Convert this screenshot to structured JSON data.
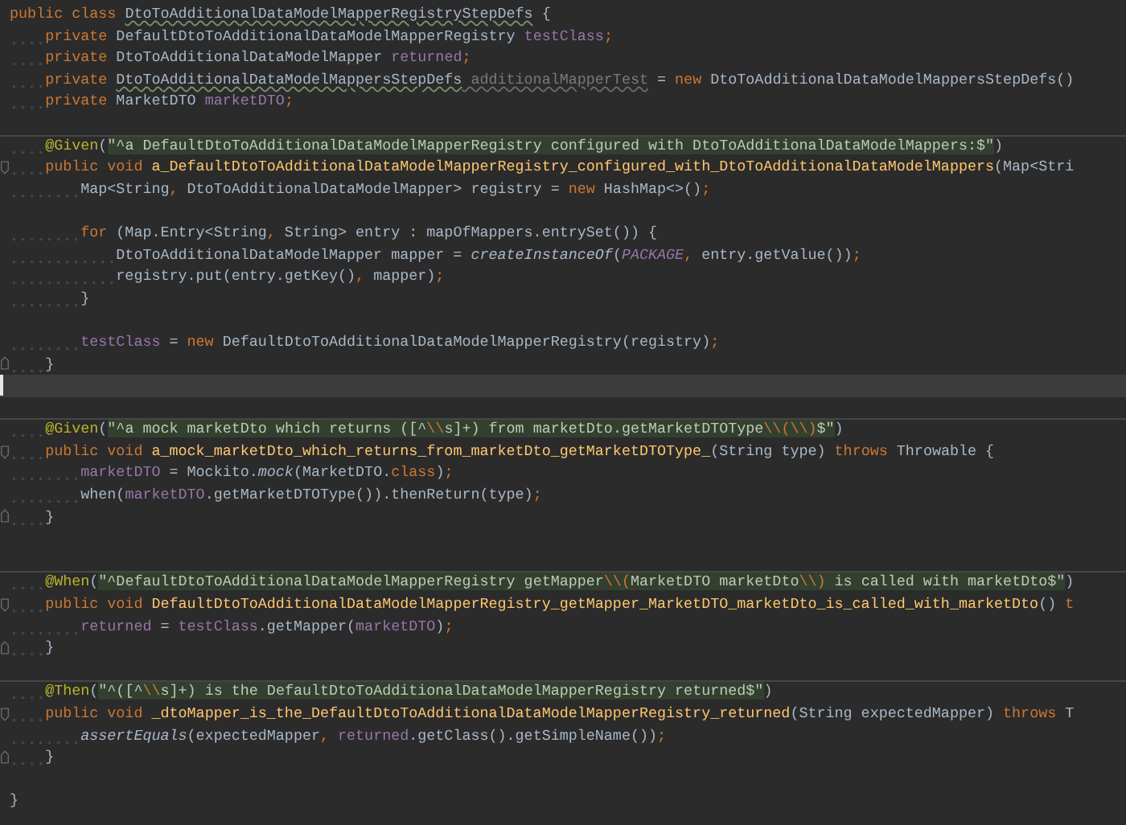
{
  "editor": {
    "blocks": [
      {
        "lines": [
          {
            "kind": "plain",
            "current": false,
            "tokens": [
              {
                "kind": "keyword",
                "text": "public class "
              },
              {
                "kind": "typo",
                "text": "DtoToAdditionalDataModelMapperRegistryStepDefs"
              },
              {
                "kind": "plain",
                "text": " {"
              }
            ]
          },
          {
            "kind": "plain",
            "current": false,
            "tokens": [
              {
                "kind": "keyword",
                "text": "    private"
              },
              {
                "kind": "plain",
                "text": " DefaultDtoToAdditionalDataModelMapperRegistry "
              },
              {
                "kind": "field",
                "text": "testClass"
              },
              {
                "kind": "punct",
                "text": ";"
              }
            ]
          },
          {
            "kind": "plain",
            "current": false,
            "tokens": [
              {
                "kind": "keyword",
                "text": "    private"
              },
              {
                "kind": "plain",
                "text": " DtoToAdditionalDataModelMapper "
              },
              {
                "kind": "field",
                "text": "returned"
              },
              {
                "kind": "punct",
                "text": ";"
              }
            ]
          },
          {
            "kind": "plain",
            "current": false,
            "tokens": [
              {
                "kind": "keyword",
                "text": "    private "
              },
              {
                "kind": "typo",
                "text": "DtoToAdditionalDataModelMappersStepDefs"
              },
              {
                "kind": "unused",
                "text": " additionalMapperTest"
              },
              {
                "kind": "plain",
                "text": " = "
              },
              {
                "kind": "keyword",
                "text": "new"
              },
              {
                "kind": "plain",
                "text": " DtoToAdditionalDataModelMappersStepDefs()"
              }
            ]
          },
          {
            "kind": "plain",
            "current": false,
            "tokens": [
              {
                "kind": "keyword",
                "text": "    private"
              },
              {
                "kind": "plain",
                "text": " MarketDTO "
              },
              {
                "kind": "field",
                "text": "marketDTO"
              },
              {
                "kind": "punct",
                "text": ";"
              }
            ]
          },
          {
            "kind": "plain",
            "current": false
          }
        ]
      },
      {
        "lines": [
          {
            "kind": "plain",
            "current": false,
            "tokens": [
              {
                "kind": "annotation",
                "text": "    @Given"
              },
              {
                "kind": "plain",
                "text": "("
              },
              {
                "kind": "string",
                "text": "\"^a DefaultDtoToAdditionalDataModelMapperRegistry configured with DtoToAdditionalDataModelMappers:$\""
              },
              {
                "kind": "plain",
                "text": ")"
              }
            ]
          },
          {
            "kind": "fold-start",
            "current": false,
            "tokens": [
              {
                "kind": "keyword",
                "text": "    public void "
              },
              {
                "kind": "method",
                "text": "a_DefaultDtoToAdditionalDataModelMapperRegistry_configured_with_DtoToAdditionalDataModelMappers"
              },
              {
                "kind": "plain",
                "text": "(Map<Stri"
              }
            ]
          },
          {
            "kind": "plain",
            "current": false,
            "tokens": [
              {
                "kind": "plain",
                "text": "        Map<String"
              },
              {
                "kind": "punct",
                "text": ","
              },
              {
                "kind": "plain",
                "text": " DtoToAdditionalDataModelMapper> registry = "
              },
              {
                "kind": "keyword",
                "text": "new"
              },
              {
                "kind": "plain",
                "text": " HashMap<>()"
              },
              {
                "kind": "punct",
                "text": ";"
              }
            ]
          },
          {
            "kind": "plain",
            "current": false
          },
          {
            "kind": "plain",
            "current": false,
            "tokens": [
              {
                "kind": "keyword",
                "text": "        for"
              },
              {
                "kind": "plain",
                "text": " (Map.Entry<String"
              },
              {
                "kind": "punct",
                "text": ","
              },
              {
                "kind": "plain",
                "text": " String> entry : mapOfMappers.entrySet()) {"
              }
            ]
          },
          {
            "kind": "plain",
            "current": false,
            "tokens": [
              {
                "kind": "plain",
                "text": "            DtoToAdditionalDataModelMapper mapper = "
              },
              {
                "kind": "italic",
                "text": "createInstanceOf"
              },
              {
                "kind": "plain",
                "text": "("
              },
              {
                "kind": "constant",
                "text": "PACKAGE"
              },
              {
                "kind": "punct",
                "text": ","
              },
              {
                "kind": "plain",
                "text": " entry.getValue())"
              },
              {
                "kind": "punct",
                "text": ";"
              }
            ]
          },
          {
            "kind": "plain",
            "current": false,
            "tokens": [
              {
                "kind": "plain",
                "text": "            registry.put(entry.getKey()"
              },
              {
                "kind": "punct",
                "text": ","
              },
              {
                "kind": "plain",
                "text": " mapper)"
              },
              {
                "kind": "punct",
                "text": ";"
              }
            ]
          },
          {
            "kind": "plain",
            "current": false,
            "tokens": [
              {
                "kind": "plain",
                "text": "        }"
              }
            ]
          },
          {
            "kind": "plain",
            "current": false
          },
          {
            "kind": "plain",
            "current": false,
            "tokens": [
              {
                "kind": "field",
                "text": "        testClass"
              },
              {
                "kind": "plain",
                "text": " = "
              },
              {
                "kind": "keyword",
                "text": "new"
              },
              {
                "kind": "plain",
                "text": " DefaultDtoToAdditionalDataModelMapperRegistry(registry)"
              },
              {
                "kind": "punct",
                "text": ";"
              }
            ]
          },
          {
            "kind": "fold-end",
            "current": false,
            "tokens": [
              {
                "kind": "plain",
                "text": "    }"
              }
            ]
          },
          {
            "kind": "plain",
            "current": true
          },
          {
            "kind": "plain",
            "current": false
          }
        ]
      },
      {
        "lines": [
          {
            "kind": "plain",
            "current": false,
            "tokens": [
              {
                "kind": "annotation",
                "text": "    @Given"
              },
              {
                "kind": "plain",
                "text": "("
              },
              {
                "kind": "string",
                "text": "\"^a mock marketDto which returns ([^"
              },
              {
                "kind": "escape",
                "text": "\\\\"
              },
              {
                "kind": "string",
                "text": "s]+) from marketDto.getMarketDTOType"
              },
              {
                "kind": "escape",
                "text": "\\\\(\\\\)"
              },
              {
                "kind": "string",
                "text": "$\""
              },
              {
                "kind": "plain",
                "text": ")"
              }
            ]
          },
          {
            "kind": "fold-start",
            "current": false,
            "tokens": [
              {
                "kind": "keyword",
                "text": "    public void "
              },
              {
                "kind": "method",
                "text": "a_mock_marketDto_which_returns_from_marketDto_getMarketDTOType_"
              },
              {
                "kind": "plain",
                "text": "(String type) "
              },
              {
                "kind": "keyword",
                "text": "throws"
              },
              {
                "kind": "plain",
                "text": " Throwable {"
              }
            ]
          },
          {
            "kind": "plain",
            "current": false,
            "tokens": [
              {
                "kind": "field",
                "text": "        marketDTO"
              },
              {
                "kind": "plain",
                "text": " = Mockito."
              },
              {
                "kind": "italic",
                "text": "mock"
              },
              {
                "kind": "plain",
                "text": "(MarketDTO."
              },
              {
                "kind": "keyword",
                "text": "class"
              },
              {
                "kind": "plain",
                "text": ")"
              },
              {
                "kind": "punct",
                "text": ";"
              }
            ]
          },
          {
            "kind": "plain",
            "current": false,
            "tokens": [
              {
                "kind": "plain",
                "text": "        when("
              },
              {
                "kind": "field",
                "text": "marketDTO"
              },
              {
                "kind": "plain",
                "text": ".getMarketDTOType()).thenReturn(type)"
              },
              {
                "kind": "punct",
                "text": ";"
              }
            ]
          },
          {
            "kind": "fold-end",
            "current": false,
            "tokens": [
              {
                "kind": "plain",
                "text": "    }"
              }
            ]
          },
          {
            "kind": "plain",
            "current": false
          },
          {
            "kind": "plain",
            "current": false
          }
        ]
      },
      {
        "lines": [
          {
            "kind": "plain",
            "current": false,
            "tokens": [
              {
                "kind": "annotation",
                "text": "    @When"
              },
              {
                "kind": "plain",
                "text": "("
              },
              {
                "kind": "string",
                "text": "\"^DefaultDtoToAdditionalDataModelMapperRegistry getMapper"
              },
              {
                "kind": "escape",
                "text": "\\\\("
              },
              {
                "kind": "string",
                "text": "MarketDTO marketDto"
              },
              {
                "kind": "escape",
                "text": "\\\\)"
              },
              {
                "kind": "string",
                "text": " is called with marketDto$\""
              },
              {
                "kind": "plain",
                "text": ")"
              }
            ]
          },
          {
            "kind": "fold-start",
            "current": false,
            "tokens": [
              {
                "kind": "keyword",
                "text": "    public void "
              },
              {
                "kind": "method",
                "text": "DefaultDtoToAdditionalDataModelMapperRegistry_getMapper_MarketDTO_marketDto_is_called_with_marketDto"
              },
              {
                "kind": "plain",
                "text": "() "
              },
              {
                "kind": "keyword",
                "text": "t"
              }
            ]
          },
          {
            "kind": "plain",
            "current": false,
            "tokens": [
              {
                "kind": "field",
                "text": "        returned"
              },
              {
                "kind": "plain",
                "text": " = "
              },
              {
                "kind": "field",
                "text": "testClass"
              },
              {
                "kind": "plain",
                "text": ".getMapper("
              },
              {
                "kind": "field",
                "text": "marketDTO"
              },
              {
                "kind": "plain",
                "text": ")"
              },
              {
                "kind": "punct",
                "text": ";"
              }
            ]
          },
          {
            "kind": "fold-end",
            "current": false,
            "tokens": [
              {
                "kind": "plain",
                "text": "    }"
              }
            ]
          },
          {
            "kind": "plain",
            "current": false
          }
        ]
      },
      {
        "lines": [
          {
            "kind": "plain",
            "current": false,
            "tokens": [
              {
                "kind": "annotation",
                "text": "    @Then"
              },
              {
                "kind": "plain",
                "text": "("
              },
              {
                "kind": "string",
                "text": "\"^([^"
              },
              {
                "kind": "escape",
                "text": "\\\\"
              },
              {
                "kind": "string",
                "text": "s]+) is the DefaultDtoToAdditionalDataModelMapperRegistry returned$\""
              },
              {
                "kind": "plain",
                "text": ")"
              }
            ]
          },
          {
            "kind": "fold-start",
            "current": false,
            "tokens": [
              {
                "kind": "keyword",
                "text": "    public void "
              },
              {
                "kind": "method",
                "text": "_dtoMapper_is_the_DefaultDtoToAdditionalDataModelMapperRegistry_returned"
              },
              {
                "kind": "plain",
                "text": "(String expectedMapper) "
              },
              {
                "kind": "keyword",
                "text": "throws"
              },
              {
                "kind": "plain",
                "text": " T"
              }
            ]
          },
          {
            "kind": "plain",
            "current": false,
            "tokens": [
              {
                "kind": "italic",
                "text": "        assertEquals"
              },
              {
                "kind": "plain",
                "text": "(expectedMapper"
              },
              {
                "kind": "punct",
                "text": ","
              },
              {
                "kind": "field",
                "text": " returned"
              },
              {
                "kind": "plain",
                "text": ".getClass().getSimpleName())"
              },
              {
                "kind": "punct",
                "text": ";"
              }
            ]
          },
          {
            "kind": "fold-end",
            "current": false,
            "tokens": [
              {
                "kind": "plain",
                "text": "    }"
              }
            ]
          },
          {
            "kind": "plain",
            "current": false
          },
          {
            "kind": "plain",
            "current": false,
            "tokens": [
              {
                "kind": "plain",
                "text": "}"
              }
            ]
          }
        ]
      }
    ]
  }
}
